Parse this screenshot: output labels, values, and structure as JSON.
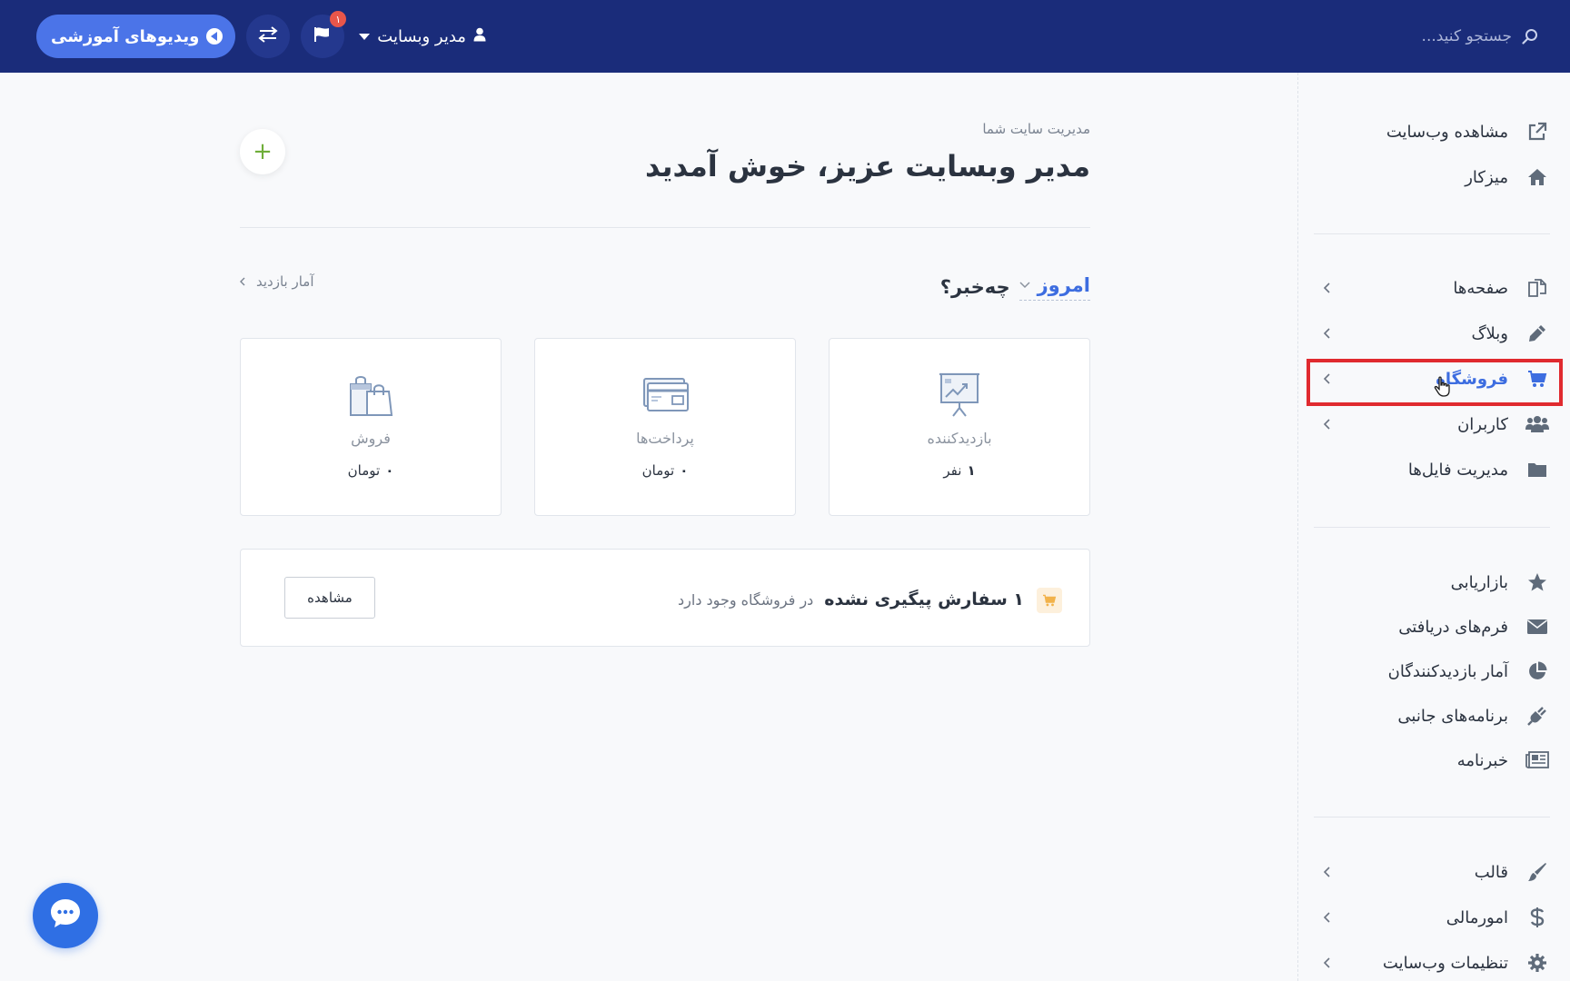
{
  "topbar": {
    "search_placeholder": "جستجو کنید...",
    "video_label": "ویدیوهای آموزشی",
    "notification_count": "۱",
    "user_name": "مدیر وبسایت"
  },
  "sidebar": {
    "items": [
      {
        "label": "مشاهده وب‌سایت",
        "icon": "external-link-icon"
      },
      {
        "label": "میزکار",
        "icon": "home-icon"
      },
      {
        "label": "صفحه‌ها",
        "icon": "pages-icon"
      },
      {
        "label": "وبلاگ",
        "icon": "pencil-icon"
      },
      {
        "label": "فروشگاه",
        "icon": "cart-icon"
      },
      {
        "label": "کاربران",
        "icon": "users-icon"
      },
      {
        "label": "مدیریت فایل‌ها",
        "icon": "folder-icon"
      },
      {
        "label": "بازاریابی",
        "icon": "star-icon"
      },
      {
        "label": "فرم‌های دریافتی",
        "icon": "envelope-icon"
      },
      {
        "label": "آمار بازدیدکنندگان",
        "icon": "pie-chart-icon"
      },
      {
        "label": "برنامه‌های جانبی",
        "icon": "plug-icon"
      },
      {
        "label": "خبرنامه",
        "icon": "newspaper-icon"
      },
      {
        "label": "قالب",
        "icon": "brush-icon"
      },
      {
        "label": "امورمالی",
        "icon": "dollar-icon"
      },
      {
        "label": "تنظیمات وب‌سایت",
        "icon": "gear-icon"
      }
    ]
  },
  "main": {
    "subtitle": "مدیریت سایت شما",
    "title": "مدیر وبسایت عزیز، خوش آمدید",
    "news": {
      "period": "امروز",
      "question": "چه‌خبر؟",
      "stats_link": "آمار بازدید"
    },
    "cards": [
      {
        "title": "بازدیدکننده",
        "value": "۱",
        "unit": "نفر",
        "icon": "presentation-chart-icon"
      },
      {
        "title": "پرداخت‌ها",
        "value": "۰",
        "unit": "تومان",
        "icon": "credit-card-icon"
      },
      {
        "title": "فروش",
        "value": "۰",
        "unit": "تومان",
        "icon": "shopping-bags-icon"
      }
    ],
    "order": {
      "strong": "۱ سفارش پیگیری نشده",
      "weak": "در فروشگاه وجود دارد",
      "button": "مشاهده"
    }
  },
  "colors": {
    "topbar": "#1a2c7a",
    "accent": "#3d6de0",
    "highlight": "#e02a2f",
    "chat": "#2f6fe4"
  }
}
